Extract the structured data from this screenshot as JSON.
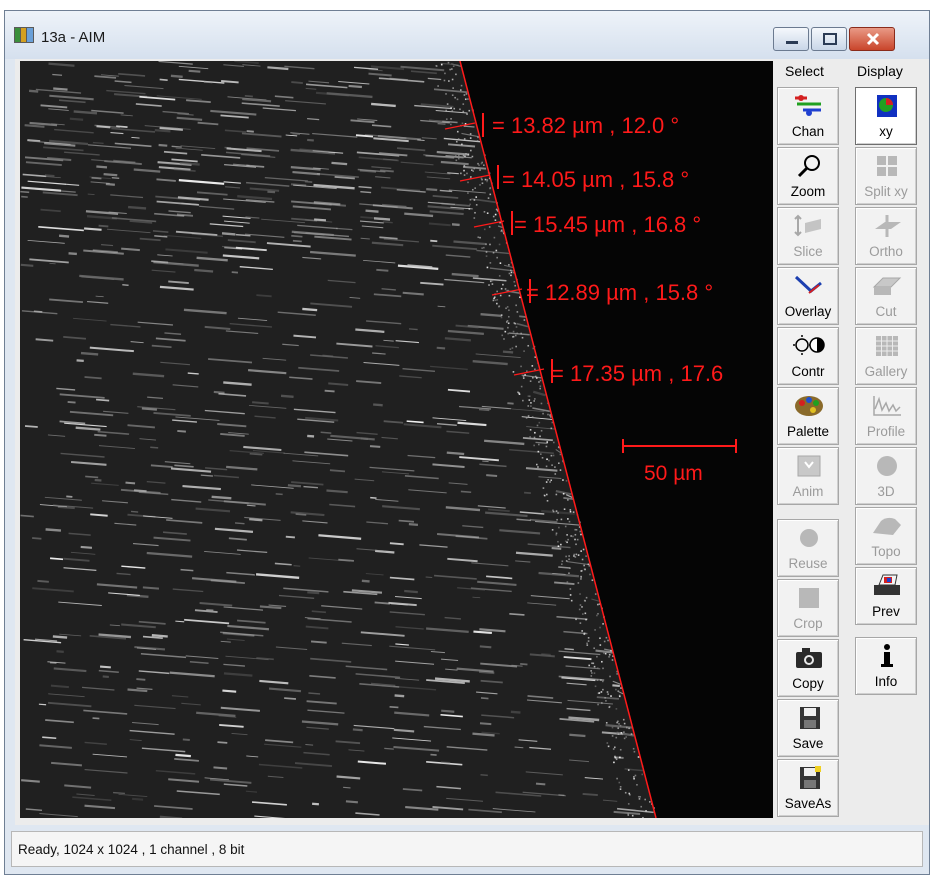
{
  "window": {
    "title": "13a - AIM",
    "icon": "app-icon",
    "controls": [
      "minimize-icon",
      "maximize-icon",
      "close-icon"
    ]
  },
  "image": {
    "measurements": [
      "= 13.82 µm ,  12.0 °",
      "= 14.05 µm ,  15.8 °",
      "= 15.45 µm ,  16.8 °",
      "= 12.89 µm ,  15.8 °",
      "= 17.35 µm ,  17.6"
    ],
    "scale_bar_label": "50 µm",
    "overlay_color": "#ff1a1a"
  },
  "toolbar": {
    "select_header": "Select",
    "display_header": "Display",
    "select_buttons": [
      {
        "label": "Chan",
        "icon": "channels-icon",
        "enabled": true
      },
      {
        "label": "Zoom",
        "icon": "magnifier-icon",
        "enabled": true
      },
      {
        "label": "Slice",
        "icon": "slice-icon",
        "enabled": false
      },
      {
        "label": "Overlay",
        "icon": "overlay-icon",
        "enabled": true
      },
      {
        "label": "Contr",
        "icon": "contrast-icon",
        "enabled": true
      },
      {
        "label": "Palette",
        "icon": "palette-icon",
        "enabled": true
      },
      {
        "label": "Anim",
        "icon": "animation-icon",
        "enabled": false
      },
      {
        "label": "Reuse",
        "icon": "reuse-icon",
        "enabled": false
      },
      {
        "label": "Crop",
        "icon": "crop-icon",
        "enabled": false
      },
      {
        "label": "Copy",
        "icon": "camera-icon",
        "enabled": true
      },
      {
        "label": "Save",
        "icon": "floppy-icon",
        "enabled": true
      },
      {
        "label": "SaveAs",
        "icon": "floppy-saveas-icon",
        "enabled": true
      }
    ],
    "display_buttons": [
      {
        "label": "xy",
        "icon": "xy-view-icon",
        "enabled": true,
        "selected": true
      },
      {
        "label": "Split xy",
        "icon": "split-grid-icon",
        "enabled": false
      },
      {
        "label": "Ortho",
        "icon": "ortho-icon",
        "enabled": false
      },
      {
        "label": "Cut",
        "icon": "cut-icon",
        "enabled": false
      },
      {
        "label": "Gallery",
        "icon": "gallery-grid-icon",
        "enabled": false
      },
      {
        "label": "Profile",
        "icon": "profile-icon",
        "enabled": false
      },
      {
        "label": "3D",
        "icon": "sphere-icon",
        "enabled": false
      },
      {
        "label": "Topo",
        "icon": "topo-icon",
        "enabled": false
      },
      {
        "label": "Prev",
        "icon": "printer-icon",
        "enabled": true
      },
      {
        "label": "Info",
        "icon": "info-icon",
        "enabled": true
      }
    ]
  },
  "status": {
    "text": "Ready, 1024 x 1024 , 1 channel , 8 bit"
  }
}
